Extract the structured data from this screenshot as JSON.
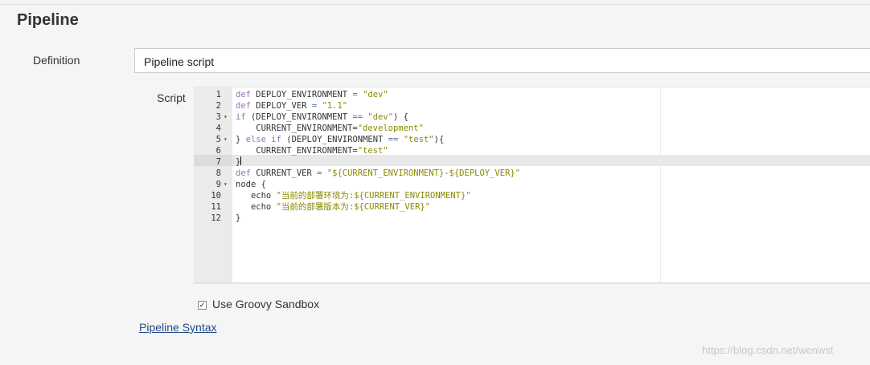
{
  "section": {
    "title": "Pipeline"
  },
  "definition": {
    "label": "Definition",
    "selected": "Pipeline script"
  },
  "script": {
    "label": "Script",
    "lines": [
      {
        "num": "1",
        "fold": "",
        "html": "<span class='kw'>def</span> DEPLOY_ENVIRONMENT <span class='op'>=</span> <span class='str'>\"dev\"</span>"
      },
      {
        "num": "2",
        "fold": "",
        "html": "<span class='kw'>def</span> DEPLOY_VER <span class='op'>=</span> <span class='str'>\"1.1\"</span>"
      },
      {
        "num": "3",
        "fold": "▾",
        "html": "<span class='kw'>if</span> (DEPLOY_ENVIRONMENT <span class='op'>==</span> <span class='str'>\"dev\"</span>) {"
      },
      {
        "num": "4",
        "fold": "",
        "html": "    CURRENT_ENVIRONMENT=<span class='str'>\"development\"</span>"
      },
      {
        "num": "5",
        "fold": "▾",
        "html": "} <span class='kw'>else</span> <span class='kw'>if</span> (DEPLOY_ENVIRONMENT <span class='op'>==</span> <span class='str'>\"test\"</span>){"
      },
      {
        "num": "6",
        "fold": "",
        "html": "    CURRENT_ENVIRONMENT=<span class='str'>\"test\"</span>"
      },
      {
        "num": "7",
        "fold": "",
        "html": "}"
      },
      {
        "num": "8",
        "fold": "",
        "html": "<span class='kw'>def</span> CURRENT_VER <span class='op'>=</span> <span class='str'>\"${CURRENT_ENVIRONMENT}-${DEPLOY_VER}\"</span>"
      },
      {
        "num": "9",
        "fold": "▾",
        "html": "node {"
      },
      {
        "num": "10",
        "fold": "",
        "html": "   echo <span class='str'>\"当前的部署环境为:${CURRENT_ENVIRONMENT}\"</span>"
      },
      {
        "num": "11",
        "fold": "",
        "html": "   echo <span class='str'>\"当前的部署版本为:${CURRENT_VER}\"</span>"
      },
      {
        "num": "12",
        "fold": "",
        "html": "}"
      }
    ]
  },
  "sandbox": {
    "label": "Use Groovy Sandbox",
    "checked": true
  },
  "syntax_link": "Pipeline Syntax",
  "watermark": "https://blog.csdn.net/wenwst"
}
